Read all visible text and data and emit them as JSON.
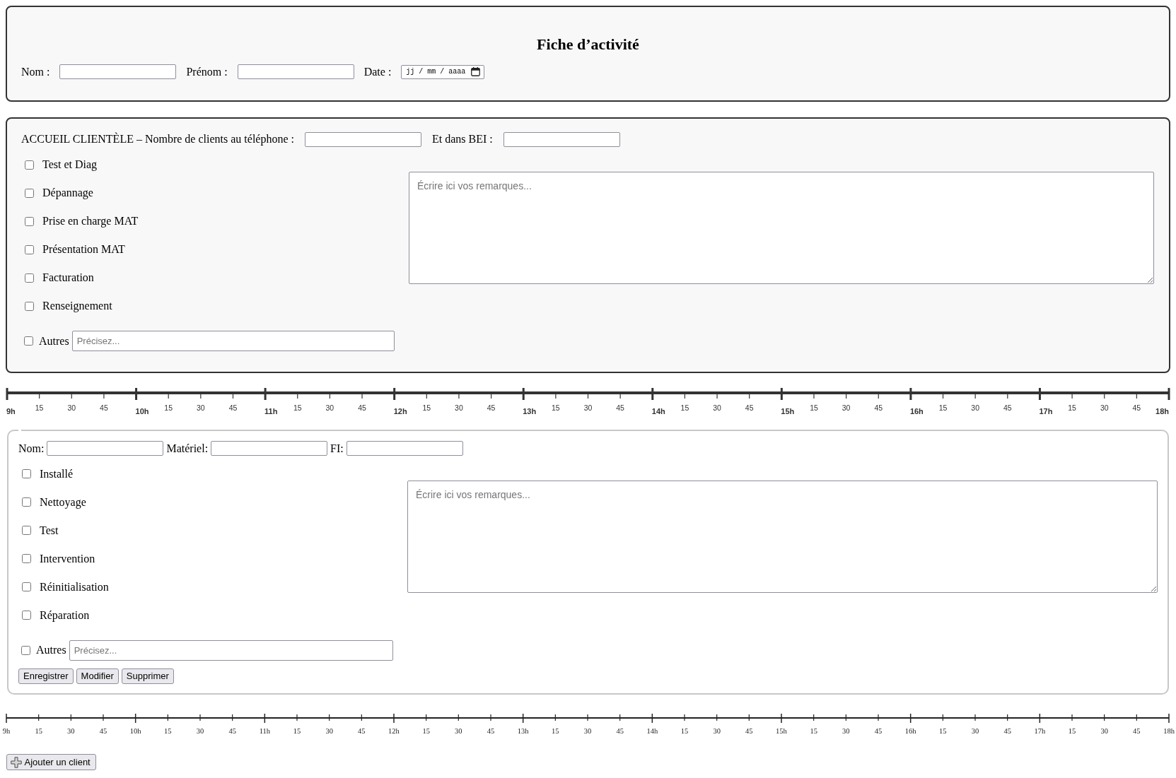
{
  "header": {
    "title": "Fiche d’activité",
    "fields": [
      {
        "kind": "text",
        "label": "Nom :"
      },
      {
        "kind": "text",
        "label": "Prénom :"
      },
      {
        "kind": "date",
        "label": "Date :",
        "placeholder": "jj / mm / aaaa"
      }
    ]
  },
  "reception": {
    "fields": [
      {
        "label": "ACCUEIL CLIENTÈLE – Nombre de clients au téléphone :"
      },
      {
        "label": "Et dans BEI :"
      }
    ],
    "tasks": [
      {
        "label": "Test et Diag",
        "checked": false
      },
      {
        "label": "Dépannage",
        "checked": false
      },
      {
        "label": "Prise en charge MAT",
        "checked": false
      },
      {
        "label": "Présentation MAT",
        "checked": false
      },
      {
        "label": "Facturation",
        "checked": false
      },
      {
        "label": "Renseignement",
        "checked": false
      }
    ],
    "other": {
      "label": "Autres",
      "checked": false,
      "placeholder": "Précisez..."
    },
    "remarks": {
      "placeholder": "Écrire ici vos remarques..."
    }
  },
  "timeline_1": {
    "kind": "bold",
    "labels": [
      "9h",
      "15",
      "30",
      "45",
      "10h",
      "15",
      "30",
      "45",
      "11h",
      "15",
      "30",
      "45",
      "12h",
      "15",
      "30",
      "45",
      "13h",
      "15",
      "30",
      "45",
      "14h",
      "15",
      "30",
      "45",
      "15h",
      "15",
      "30",
      "45",
      "16h",
      "15",
      "30",
      "45",
      "17h",
      "15",
      "30",
      "45",
      "18h"
    ]
  },
  "client": {
    "fields": [
      {
        "label": "Nom:"
      },
      {
        "label": "Matériel:"
      },
      {
        "label": "FI:"
      }
    ],
    "tasks": [
      {
        "label": "Installé",
        "checked": false
      },
      {
        "label": "Nettoyage",
        "checked": false
      },
      {
        "label": "Test",
        "checked": false
      },
      {
        "label": "Intervention",
        "checked": false
      },
      {
        "label": "Réinitialisation",
        "checked": false
      },
      {
        "label": "Réparation",
        "checked": false
      }
    ],
    "other": {
      "label": "Autres",
      "checked": false,
      "placeholder": "Précisez..."
    },
    "remarks": {
      "placeholder": "Écrire ici vos remarques..."
    },
    "buttons": [
      "Enregistrer",
      "Modifier",
      "Supprimer"
    ]
  },
  "timeline_2": {
    "kind": "plain",
    "labels": [
      "9h",
      "15",
      "30",
      "45",
      "10h",
      "15",
      "30",
      "45",
      "11h",
      "15",
      "30",
      "45",
      "12h",
      "15",
      "30",
      "45",
      "13h",
      "15",
      "30",
      "45",
      "14h",
      "15",
      "30",
      "45",
      "15h",
      "15",
      "30",
      "45",
      "16h",
      "15",
      "30",
      "45",
      "17h",
      "15",
      "30",
      "45",
      "18h"
    ]
  },
  "add_client_button": {
    "label": "Ajouter un client"
  }
}
